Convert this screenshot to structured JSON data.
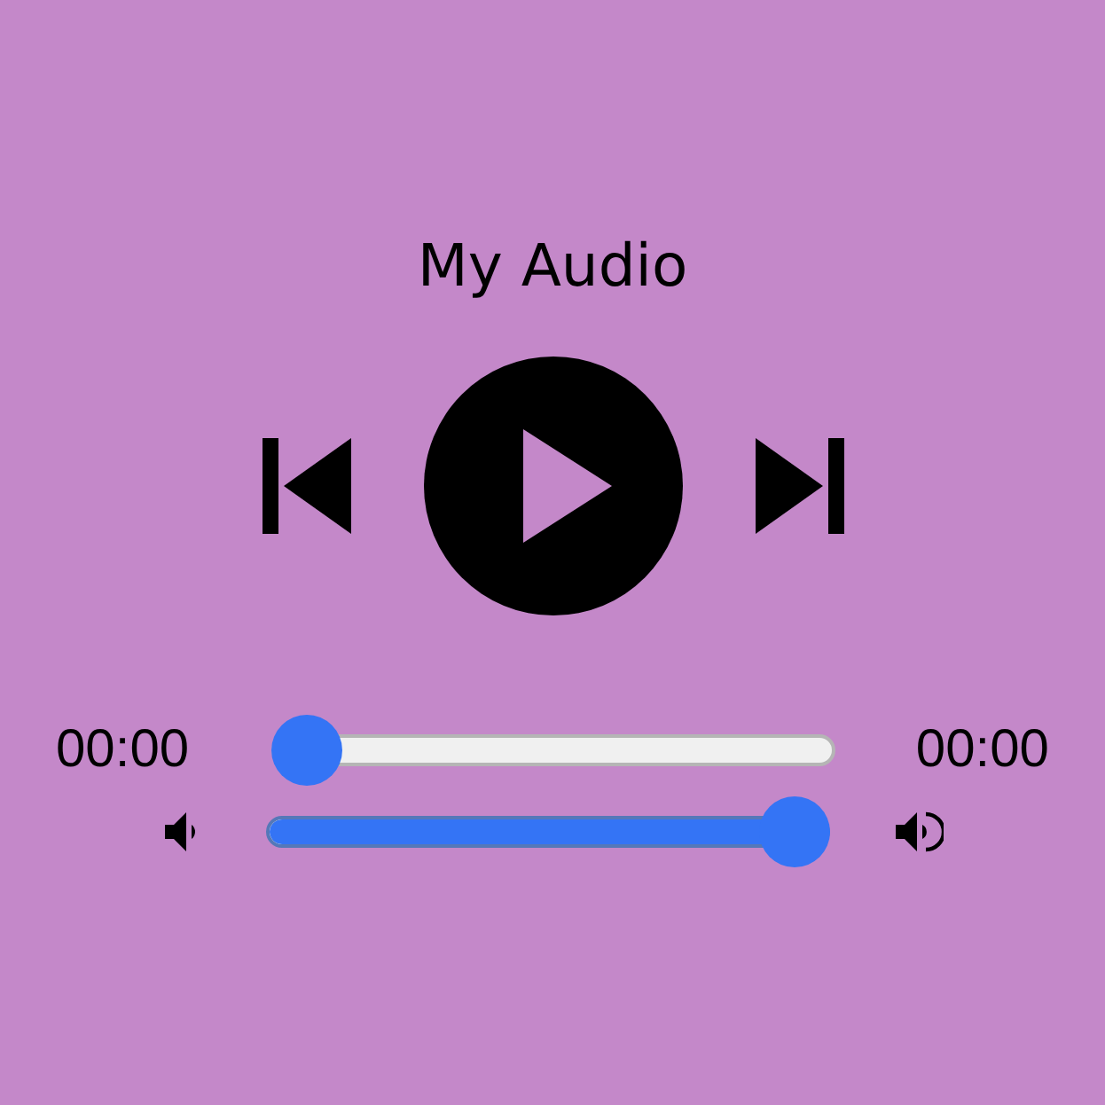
{
  "title": "My Audio",
  "player": {
    "playing": false
  },
  "progress": {
    "current_time": "00:00",
    "level": 0,
    "duration": "00:00"
  },
  "volume": {
    "level": 1
  }
}
